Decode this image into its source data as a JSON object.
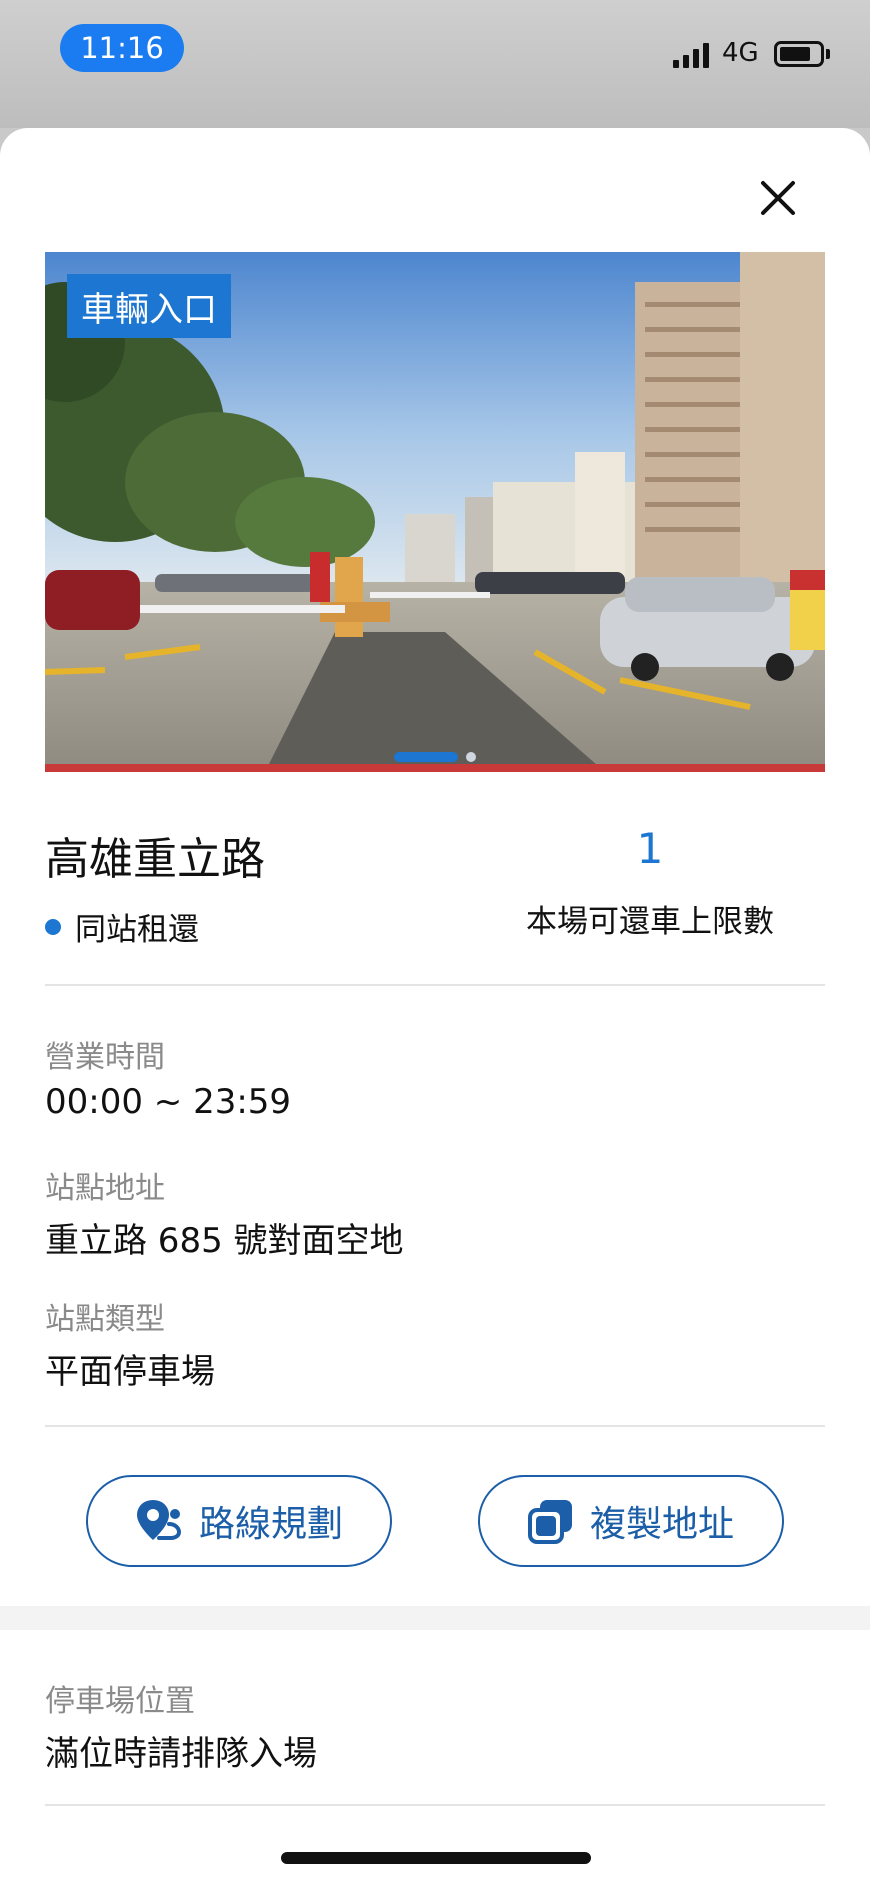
{
  "status_bar": {
    "time": "11:16",
    "network": "4G",
    "battery_level": 0.85
  },
  "photo": {
    "badge": "車輛入口",
    "page_count": 2,
    "active_page": 1
  },
  "station": {
    "name": "高雄重立路",
    "feature": "同站租還",
    "return_limit_value": "1",
    "return_limit_label": "本場可還車上限數"
  },
  "details": [
    {
      "label": "營業時間",
      "value": "00:00 ~ 23:59"
    },
    {
      "label": "站點地址",
      "value": "重立路 685 號對面空地"
    },
    {
      "label": "站點類型",
      "value": "平面停車場"
    }
  ],
  "actions": {
    "route": "路線規劃",
    "copy": "複製地址"
  },
  "parking": {
    "label": "停車場位置",
    "value": "滿位時請排隊入場"
  },
  "colors": {
    "accent": "#1c76d2",
    "button_border": "#1c5fa8",
    "label_gray": "#8a8a8a"
  },
  "icons": {
    "close": "close-icon",
    "route": "map-pin-route-icon",
    "copy": "copy-icon"
  }
}
